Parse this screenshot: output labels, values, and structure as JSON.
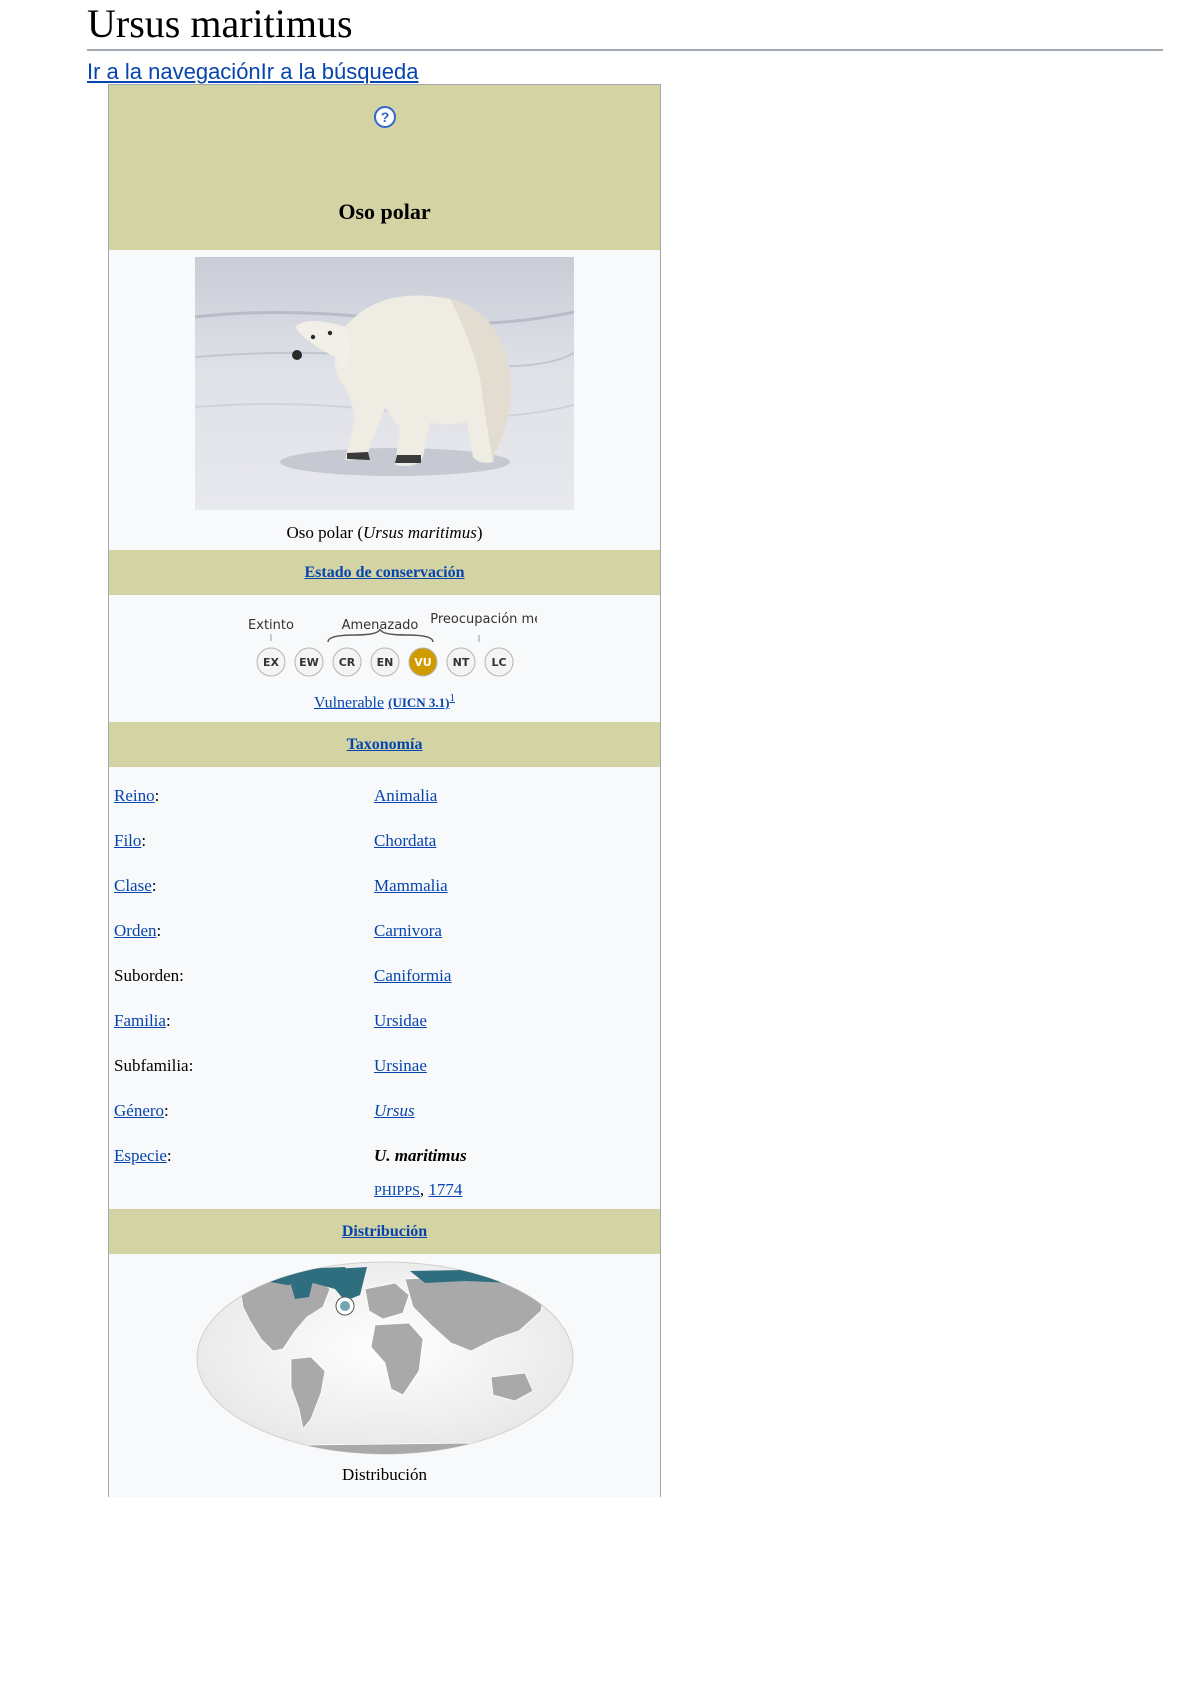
{
  "page": {
    "title": "Ursus maritimus",
    "skip_links": [
      "Ir a la navegación",
      "Ir a la búsqueda"
    ]
  },
  "infobox": {
    "name": "Oso polar",
    "photo_caption_prefix": "Oso polar (",
    "photo_caption_italic": "Ursus maritimus",
    "photo_caption_suffix": ")",
    "conservation_header": "Estado de conservación",
    "iucn_scale": {
      "group_labels": [
        "Extinto",
        "Amenazado",
        "Preocupación menor"
      ],
      "categories": [
        "EX",
        "EW",
        "CR",
        "EN",
        "VU",
        "NT",
        "LC"
      ],
      "selected": "VU",
      "selected_color": "#d19b00"
    },
    "status_link": "Vulnerable",
    "status_source": "(UICN 3.1)",
    "status_ref": "1",
    "taxonomy_header": "Taxonomía",
    "taxonomy": [
      {
        "rank": "Reino",
        "value": "Animalia"
      },
      {
        "rank": "Filo",
        "value": "Chordata"
      },
      {
        "rank": "Clase",
        "value": "Mammalia"
      },
      {
        "rank": "Orden",
        "value": "Carnivora"
      },
      {
        "rank": "Suborden",
        "value": "Caniformia"
      },
      {
        "rank": "Familia",
        "value": "Ursidae"
      },
      {
        "rank": "Subfamilia",
        "value": "Ursinae"
      },
      {
        "rank": "Género",
        "value": "Ursus"
      },
      {
        "rank": "Especie",
        "value": "U. maritimus"
      }
    ],
    "authority_name": "PHIPPS",
    "authority_sep": ", ",
    "authority_year": "1774",
    "distribution_header": "Distribución",
    "map_caption": "Distribución"
  }
}
